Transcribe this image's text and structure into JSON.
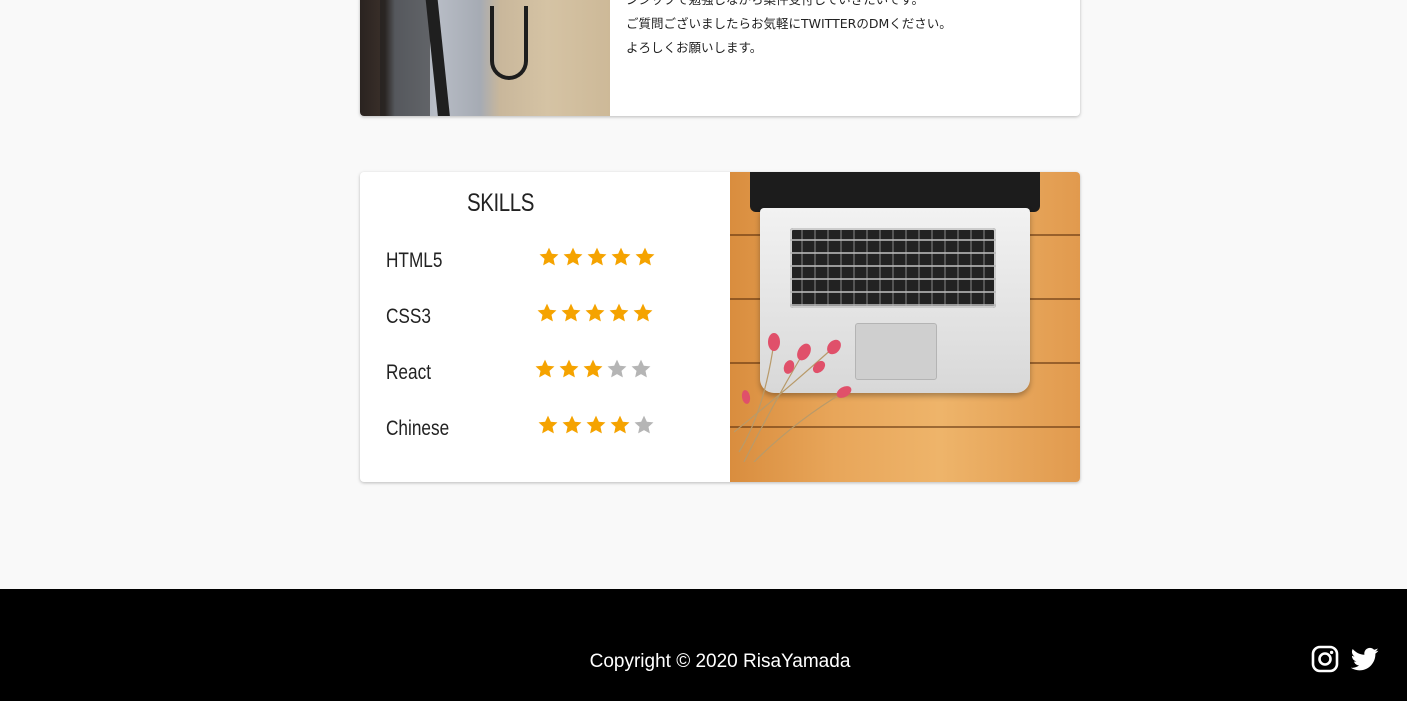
{
  "about": {
    "lines": [
      "ンシップで勉強しながら案件受付していきたいです。",
      "ご質問ございましたらお気軽にTWITTERのDMください。",
      "よろしくお願いします。"
    ]
  },
  "skills": {
    "title": "SKILLS",
    "items": [
      {
        "name": "HTML5",
        "rating": 5,
        "max": 5
      },
      {
        "name": "CSS3",
        "rating": 5,
        "max": 5
      },
      {
        "name": "React",
        "rating": 3,
        "max": 5
      },
      {
        "name": "Chinese",
        "rating": 4,
        "max": 5
      }
    ]
  },
  "footer": {
    "copyright": "Copyright © 2020 RisaYamada",
    "social": [
      {
        "name": "instagram-icon"
      },
      {
        "name": "twitter-icon"
      }
    ]
  },
  "colors": {
    "star_filled": "#f5a300",
    "star_empty": "#b5b5b5",
    "footer_bg": "#000000",
    "page_bg": "#f9f9f9"
  }
}
